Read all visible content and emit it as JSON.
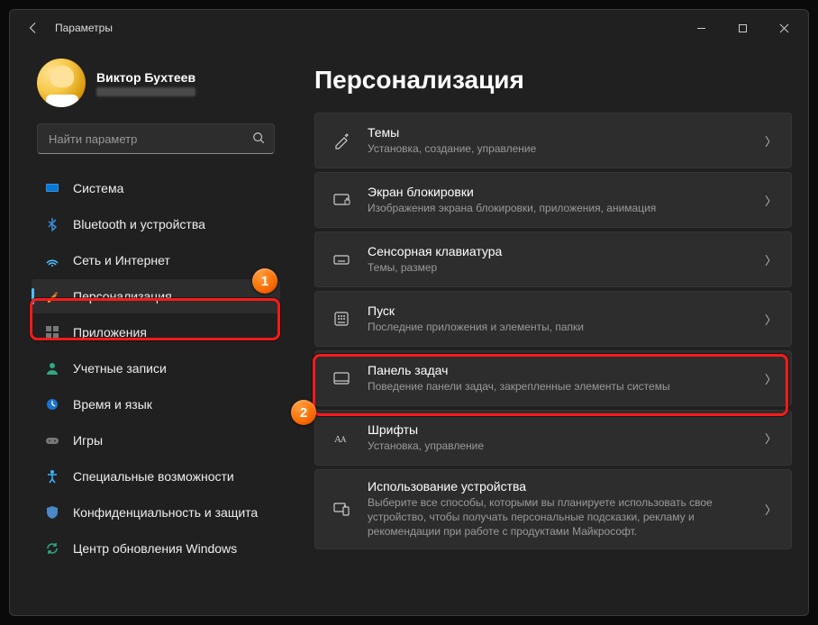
{
  "titlebar": {
    "title": "Параметры"
  },
  "profile": {
    "name": "Виктор Бухтеев"
  },
  "search": {
    "placeholder": "Найти параметр"
  },
  "nav": {
    "items": [
      {
        "id": "system",
        "label": "Система"
      },
      {
        "id": "bluetooth",
        "label": "Bluetooth и устройства"
      },
      {
        "id": "network",
        "label": "Сеть и Интернет"
      },
      {
        "id": "personalize",
        "label": "Персонализация"
      },
      {
        "id": "apps",
        "label": "Приложения"
      },
      {
        "id": "accounts",
        "label": "Учетные записи"
      },
      {
        "id": "time",
        "label": "Время и язык"
      },
      {
        "id": "gaming",
        "label": "Игры"
      },
      {
        "id": "accessibility",
        "label": "Специальные возможности"
      },
      {
        "id": "privacy",
        "label": "Конфиденциальность и защита"
      },
      {
        "id": "update",
        "label": "Центр обновления Windows"
      }
    ],
    "activeIndex": 3
  },
  "main": {
    "heading": "Персонализация",
    "tiles": [
      {
        "id": "themes",
        "title": "Темы",
        "desc": "Установка, создание, управление"
      },
      {
        "id": "lockscreen",
        "title": "Экран блокировки",
        "desc": "Изображения экрана блокировки, приложения, анимация"
      },
      {
        "id": "touchkbd",
        "title": "Сенсорная клавиатура",
        "desc": "Темы, размер"
      },
      {
        "id": "start",
        "title": "Пуск",
        "desc": "Последние приложения и элементы, папки"
      },
      {
        "id": "taskbar",
        "title": "Панель задач",
        "desc": "Поведение панели задач, закрепленные элементы системы"
      },
      {
        "id": "fonts",
        "title": "Шрифты",
        "desc": "Установка, управление"
      },
      {
        "id": "deviceuse",
        "title": "Использование устройства",
        "desc": "Выберите все способы, которыми вы планируете использовать свое устройство, чтобы получать персональные подсказки, рекламу и рекомендации при работе с продуктами Майкрософт."
      }
    ]
  },
  "annotations": {
    "1": "1",
    "2": "2"
  }
}
